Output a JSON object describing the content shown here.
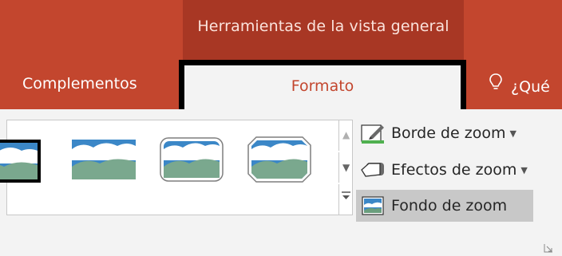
{
  "contextual_group": {
    "label": "Herramientas de la vista general"
  },
  "tabs": {
    "complementos": "Complementos",
    "formato": "Formato"
  },
  "tell_me": {
    "text": "¿Qué"
  },
  "ribbon": {
    "gallery": {
      "thumbnails": [
        "zoom-style-1",
        "zoom-style-2",
        "zoom-style-3",
        "zoom-style-4"
      ]
    },
    "commands": {
      "borde": "Borde de zoom",
      "efectos": "Efectos de zoom",
      "fondo": "Fondo de zoom"
    }
  },
  "colors": {
    "title_bar": "#c3462e",
    "contextual": "#a83724",
    "accent_text": "#c3462e"
  }
}
